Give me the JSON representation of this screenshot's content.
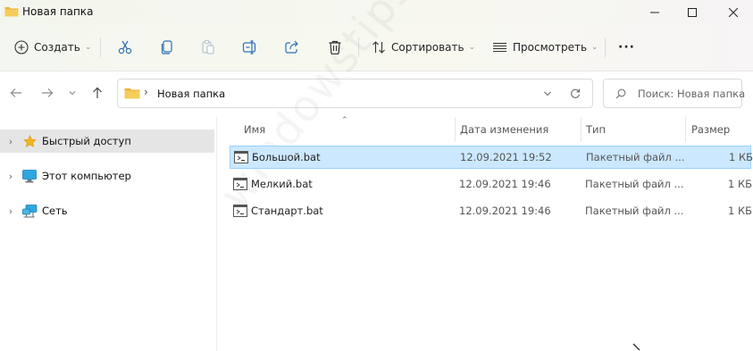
{
  "window": {
    "title": "Новая папка",
    "minimize_icon": "minimize-icon",
    "maximize_icon": "maximize-icon",
    "close_icon": "close-icon"
  },
  "toolbar": {
    "new_label": "Создать",
    "sort_label": "Сортировать",
    "view_label": "Просмотреть",
    "more_label": "···"
  },
  "address": {
    "path": "Новая папка",
    "search_placeholder": "Поиск: Новая папка"
  },
  "sidebar": {
    "items": [
      {
        "label": "Быстрый доступ",
        "icon": "star-icon"
      },
      {
        "label": "Этот компьютер",
        "icon": "computer-icon"
      },
      {
        "label": "Сеть",
        "icon": "network-icon"
      }
    ]
  },
  "columns": {
    "name": "Имя",
    "date": "Дата изменения",
    "type": "Тип",
    "size": "Размер"
  },
  "files": [
    {
      "name": "Большой.bat",
      "date": "12.09.2021 19:52",
      "type": "Пакетный файл ...",
      "size": "1 КБ"
    },
    {
      "name": "Мелкий.bat",
      "date": "12.09.2021 19:46",
      "type": "Пакетный файл ...",
      "size": "1 КБ"
    },
    {
      "name": "Стандарт.bat",
      "date": "12.09.2021 19:46",
      "type": "Пакетный файл ...",
      "size": "1 КБ"
    }
  ],
  "watermark": "windowstips.ru",
  "colors": {
    "selection": "#cce8ff",
    "selection_border": "#99d1ff",
    "folder": "#f2c14e",
    "accent": "#0067c0"
  }
}
